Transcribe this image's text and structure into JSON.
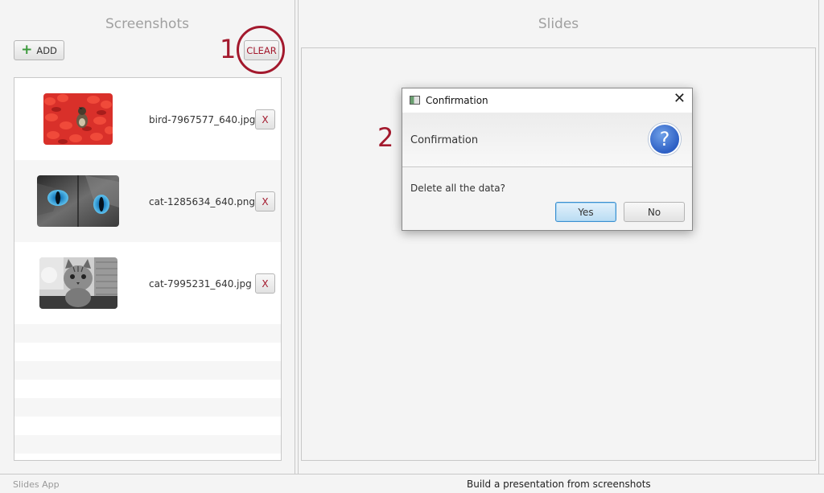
{
  "app": {
    "name": "Slides App",
    "status": "Build a presentation from screenshots"
  },
  "left_panel": {
    "title": "Screenshots",
    "add_label": "ADD",
    "clear_label": "CLEAR",
    "items": [
      {
        "filename": "bird-7967577_640.jpg",
        "remove_label": "X",
        "thumb": "red-tulips-bird"
      },
      {
        "filename": "cat-1285634_640.png",
        "remove_label": "X",
        "thumb": "cat-blue-eyes"
      },
      {
        "filename": "cat-7995231_640.jpg",
        "remove_label": "X",
        "thumb": "tabby-cat-bw"
      }
    ]
  },
  "right_panel": {
    "title": "Slides"
  },
  "annotations": {
    "step1": "1",
    "step2": "2",
    "color": "#a3192d"
  },
  "dialog": {
    "window_title": "Confirmation",
    "header": "Confirmation",
    "icon": "question-icon",
    "content": "Delete all the data?",
    "yes_label": "Yes",
    "no_label": "No",
    "close_glyph": "✕"
  }
}
